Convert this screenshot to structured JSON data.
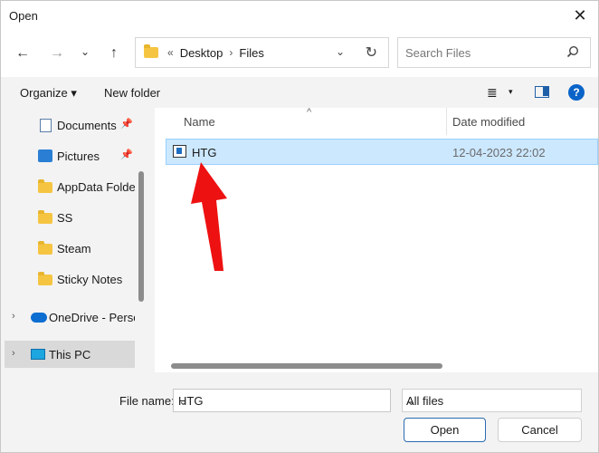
{
  "window": {
    "title": "Open",
    "close_symbol": "✕"
  },
  "nav": {
    "back": "←",
    "forward": "→",
    "recent": "⌄",
    "up": "↑"
  },
  "address": {
    "overflow": "«",
    "crumbs": [
      "Desktop",
      "Files"
    ],
    "separator": "›",
    "dropdown": "⌄",
    "refresh": "↻"
  },
  "search": {
    "placeholder": "Search Files"
  },
  "toolbar": {
    "organize": "Organize ▾",
    "new_folder": "New folder",
    "view_icon": "≣",
    "view_chevron": "▾",
    "help": "?"
  },
  "sidebar": {
    "items": [
      {
        "label": "Documents",
        "icon": "documents-icon",
        "pinned": true
      },
      {
        "label": "Pictures",
        "icon": "pictures-icon",
        "pinned": true
      },
      {
        "label": "AppData Folder",
        "icon": "folder-icon",
        "pinned": false
      },
      {
        "label": "SS",
        "icon": "folder-icon",
        "pinned": false
      },
      {
        "label": "Steam",
        "icon": "folder-icon",
        "pinned": false
      },
      {
        "label": "Sticky Notes",
        "icon": "folder-icon",
        "pinned": false
      },
      {
        "label": "OneDrive - Perso",
        "icon": "onedrive-icon",
        "expander": "›"
      },
      {
        "label": "This PC",
        "icon": "this-pc-icon",
        "expander": "›",
        "selected": true
      }
    ],
    "pin_symbol": "📌"
  },
  "columns": {
    "name": "Name",
    "date": "Date modified",
    "sort_caret": "^"
  },
  "files": [
    {
      "name": "HTG",
      "date": "12-04-2023 22:02",
      "selected": true
    }
  ],
  "bottom": {
    "file_name_label": "File name:",
    "file_name_value": "HTG",
    "file_type": "All files",
    "open": "Open",
    "cancel": "Cancel",
    "chevron": "⌄"
  },
  "colors": {
    "selection": "#cce8ff",
    "accent": "#2b6cb0",
    "annotation_arrow": "#ee1111"
  }
}
